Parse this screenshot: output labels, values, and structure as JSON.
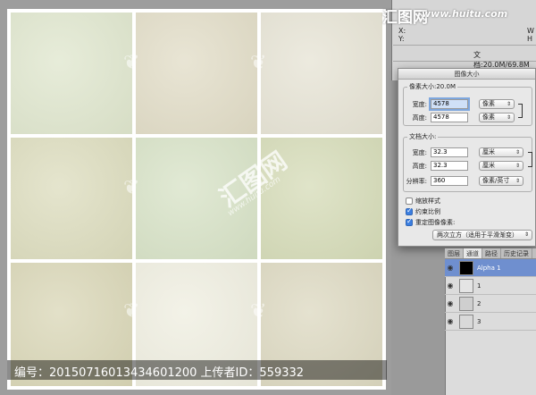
{
  "watermark": {
    "logo_text": "汇图网",
    "url_text": "www.huitu.com",
    "center_text": "汇图网",
    "center_url": "www.huitu.com",
    "bottom_text": "编号：20150716013434601200 上传者ID：559332"
  },
  "tiles": [
    {
      "color": "#dfe6cd"
    },
    {
      "color": "#e1dcc6"
    },
    {
      "color": "#e6e3d4"
    },
    {
      "color": "#dcdcbd"
    },
    {
      "color": "#d7e2c6"
    },
    {
      "color": "#d5dbb7"
    },
    {
      "color": "#d9d6b6"
    },
    {
      "color": "#efeee0"
    },
    {
      "color": "#dcd8c0"
    }
  ],
  "info_panel": {
    "xy_label_x": "X:",
    "xy_label_y": "Y:",
    "w_label": "W",
    "h_label": "H",
    "doc_size": "文档:20.0M/69.8M"
  },
  "dialog": {
    "title": "图像大小",
    "pixel_dims_label": "像素大小:20.0M",
    "pixel_width_label": "宽度:",
    "pixel_width_value": "4578",
    "pixel_width_unit": "像素",
    "pixel_height_label": "高度:",
    "pixel_height_value": "4578",
    "pixel_height_unit": "像素",
    "doc_size_label": "文档大小:",
    "doc_width_label": "宽度:",
    "doc_width_value": "32.3",
    "doc_width_unit": "厘米",
    "doc_height_label": "高度:",
    "doc_height_value": "32.3",
    "doc_height_unit": "厘米",
    "resolution_label": "分辨率:",
    "resolution_value": "360",
    "resolution_unit": "像素/英寸",
    "scale_styles_label": "缩放样式",
    "scale_styles_checked": false,
    "constrain_label": "约束比例",
    "constrain_checked": true,
    "resample_label": "重定图像像素:",
    "resample_checked": true,
    "resample_method": "两次立方（适用于平滑渐变）"
  },
  "layers_panel": {
    "tabs": [
      "图层",
      "通道",
      "路径",
      "历史记录"
    ],
    "active_tab": "通道",
    "layers": [
      {
        "name": "Alpha 1",
        "selected": true
      },
      {
        "name": "1",
        "selected": false
      },
      {
        "name": "2",
        "selected": false
      },
      {
        "name": "3",
        "selected": false
      }
    ]
  }
}
